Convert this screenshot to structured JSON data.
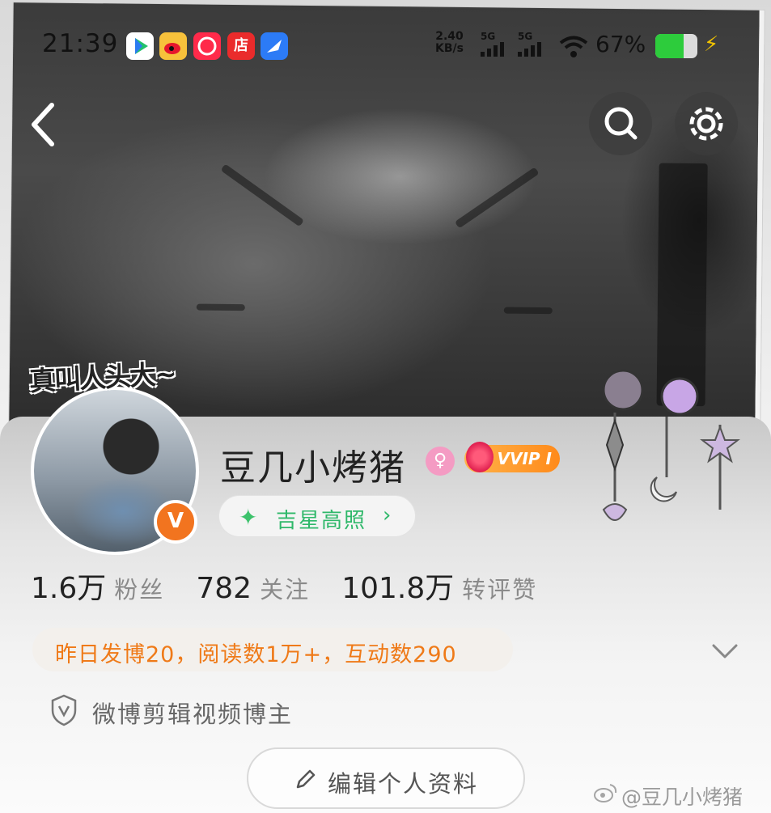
{
  "status_bar": {
    "time": "21:39",
    "app_icons": [
      "app-store-icon",
      "weibo-icon",
      "tmall-icon",
      "shop-icon",
      "feather-icon"
    ],
    "shop_glyph": "店",
    "net_speed_value": "2.40",
    "net_speed_unit": "KB/s",
    "sim1": "5G",
    "sim2": "5G",
    "battery_percent": "67%",
    "battery_level": 0.67,
    "battery_color": "#2dcc3c"
  },
  "cover": {
    "caption": "真叫人头大~"
  },
  "profile": {
    "username": "豆几小烤猪",
    "vip_label": "VVIP Ⅰ",
    "verified_badge": "V",
    "gender_glyph": "♀",
    "lucky_label": "吉星高照",
    "lucky_chevron": "›",
    "stats": [
      {
        "value": "1.6万",
        "label": "粉丝"
      },
      {
        "value": "782",
        "label": "关注"
      },
      {
        "value": "101.8万",
        "label": "转评赞"
      }
    ],
    "activity_summary": "昨日发博20，阅读数1万+，互动数290",
    "certification": "微博剪辑视频博主",
    "edit_button": "编辑个人资料",
    "accent_color": "#ef7a18"
  },
  "watermark": "@豆几小烤猪"
}
